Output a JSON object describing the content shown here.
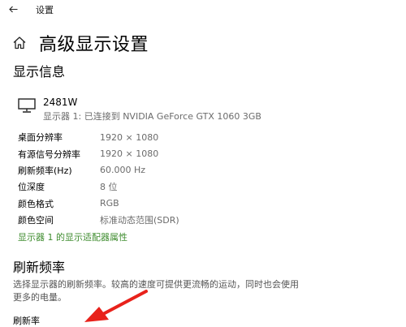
{
  "app_title": "设置",
  "page_title": "高级显示设置",
  "display_info": {
    "section_title": "显示信息",
    "monitor_name": "2481W",
    "monitor_connection": "显示器 1: 已连接到 NVIDIA GeForce GTX 1060 3GB",
    "rows": [
      {
        "label": "桌面分辨率",
        "value": "1920 × 1080"
      },
      {
        "label": "有源信号分辨率",
        "value": "1920 × 1080"
      },
      {
        "label": "刷新频率(Hz)",
        "value": "60.000 Hz"
      },
      {
        "label": "位深度",
        "value": "8 位"
      },
      {
        "label": "颜色格式",
        "value": "RGB"
      },
      {
        "label": "颜色空间",
        "value": "标准动态范围(SDR)"
      }
    ],
    "adapter_link": "显示器 1 的显示适配器属性"
  },
  "refresh_rate": {
    "section_title": "刷新频率",
    "description": "选择显示器的刷新频率。较高的速度可提供更流畅的运动，同时也会使用更多的电量。",
    "field_label": "刷新率"
  },
  "colors": {
    "link": "#3f8c2f",
    "annotation_arrow": "#e8221b",
    "secondary_text": "#6b6b6b"
  },
  "icons": {
    "back": "back-arrow-icon",
    "home": "home-icon",
    "monitor": "monitor-icon"
  }
}
